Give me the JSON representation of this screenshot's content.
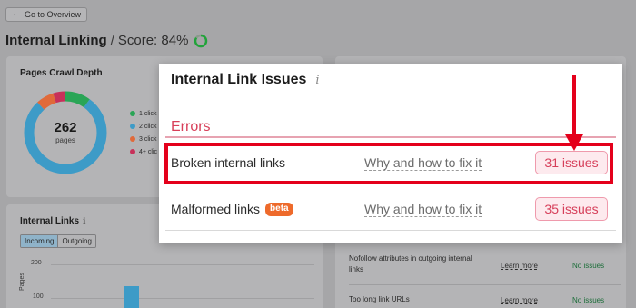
{
  "nav": {
    "back_label": "Go to Overview",
    "back_icon": "arrow-left-icon"
  },
  "header": {
    "title": "Internal Linking",
    "separator": "/",
    "score_text": "Score: 84%",
    "score_value": 84,
    "score_color": "#21a33a"
  },
  "crawl_depth": {
    "title": "Pages Crawl Depth",
    "total": "262",
    "unit": "pages",
    "legend": [
      {
        "label": "1 click",
        "color": "#2aa556"
      },
      {
        "label": "2 click",
        "color": "#3d9bc7"
      },
      {
        "label": "3 click",
        "color": "#e06a3a"
      },
      {
        "label": "4+ clic",
        "color": "#c7315a"
      }
    ],
    "segments": [
      {
        "label": "1 click",
        "fraction": 0.1,
        "color": "#2aa556"
      },
      {
        "label": "2 click",
        "fraction": 0.78,
        "color": "#3d9bc7"
      },
      {
        "label": "3 click",
        "fraction": 0.07,
        "color": "#e06a3a"
      },
      {
        "label": "4+ clic",
        "fraction": 0.05,
        "color": "#c7315a"
      }
    ]
  },
  "internal_links": {
    "title": "Internal Links",
    "info_icon": "info-icon",
    "tabs": [
      "Incoming",
      "Outgoing"
    ],
    "active_tab": "Incoming",
    "axis_ticks": [
      "200",
      "100"
    ],
    "axis_title": "Pages"
  },
  "right_panel": {
    "rows": [
      {
        "label": "Nofollow attributes in outgoing internal links",
        "link": "Learn more",
        "status": "No issues"
      },
      {
        "label": "Too long link URLs",
        "link": "Learn more",
        "status": "No issues"
      }
    ]
  },
  "popup": {
    "title": "Internal Link Issues",
    "info_icon": "info-icon",
    "section_label": "Errors",
    "issues": [
      {
        "name": "Broken internal links",
        "badge": "",
        "fix_link": "Why and how to fix it",
        "count": "31 issues"
      },
      {
        "name": "Malformed links",
        "badge": "beta",
        "fix_link": "Why and how to fix it",
        "count": "35 issues"
      }
    ]
  },
  "annotation": {
    "color": "#e4001b"
  }
}
